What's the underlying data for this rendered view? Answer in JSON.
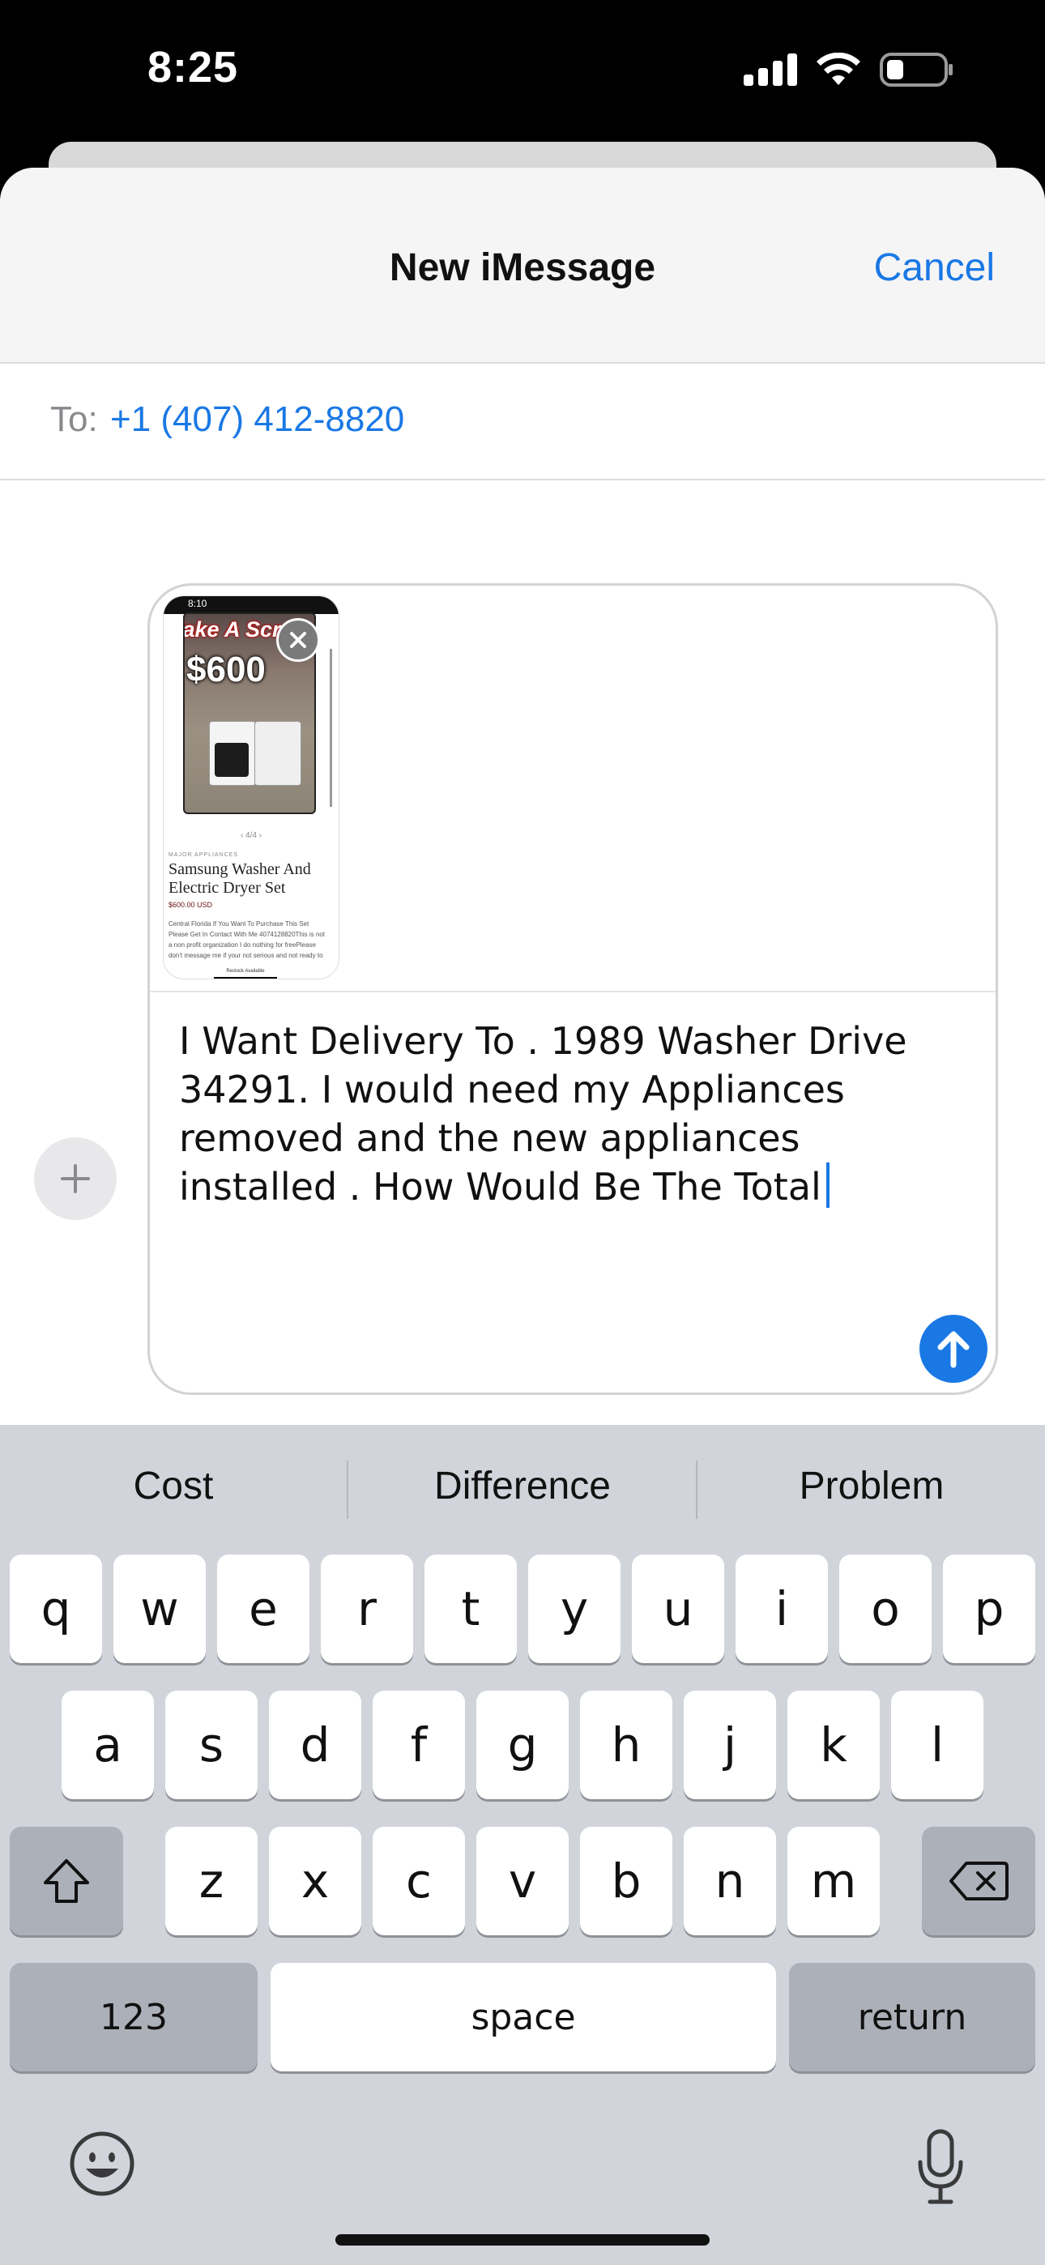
{
  "status_bar": {
    "time": "8:25",
    "icons": [
      "cellular-signal-icon",
      "wifi-icon",
      "battery-icon"
    ]
  },
  "compose": {
    "title": "New iMessage",
    "cancel_label": "Cancel",
    "to_label": "To:",
    "recipient": "+1 (407) 412-8820"
  },
  "attachment": {
    "status_time": "8:10",
    "banner": "Take A Screenshot",
    "price_overlay": "$600",
    "page_indicator": "‹  4/4  ›",
    "category": "MAJOR APPLIANCES",
    "title": "Samsung Washer And Electric Dryer Set",
    "price": "$600.00 USD",
    "description": "Central Florida If You Want To Purchase This Set Please Get In Contact With Me 4074128820This is not a non profit organization I do nothing for freePlease don't message me if your not serious and not ready to",
    "bottom_label": "Restock Available"
  },
  "message": {
    "text": "I Want Delivery To . 1989 Washer Drive 34291. I would need my  Appliances removed and the new appliances installed . How Would Be The Total"
  },
  "keyboard": {
    "suggestions": [
      "Cost",
      "Difference",
      "Problem"
    ],
    "row1": [
      "q",
      "w",
      "e",
      "r",
      "t",
      "y",
      "u",
      "i",
      "o",
      "p"
    ],
    "row2": [
      "a",
      "s",
      "d",
      "f",
      "g",
      "h",
      "j",
      "k",
      "l"
    ],
    "row3": [
      "z",
      "x",
      "c",
      "v",
      "b",
      "n",
      "m"
    ],
    "numbers_label": "123",
    "space_label": "space",
    "return_label": "return"
  },
  "colors": {
    "accent": "#1a78e5",
    "keyboard_bg": "#d1d4da",
    "key_bg": "#ffffff",
    "key_dark_bg": "#acb0b8"
  }
}
